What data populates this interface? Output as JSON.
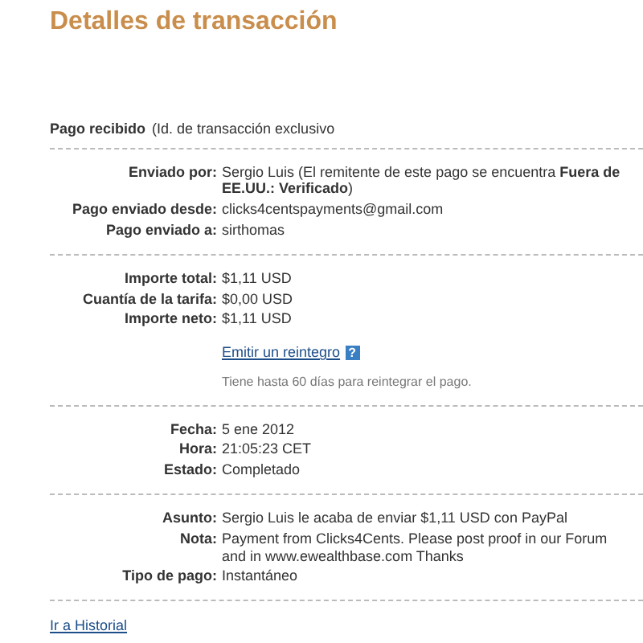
{
  "title": "Detalles de transacción",
  "intro": {
    "label": "Pago recibido",
    "text": "(Id. de transacción exclusivo"
  },
  "sections": [
    {
      "rows": [
        {
          "kind": "field",
          "label": "Enviado por:",
          "value": "Sergio Luis (El remitente de este pago se encuentra **Fuera de EE.UU.: Verificado**)"
        },
        {
          "kind": "field",
          "label": "Pago enviado desde:",
          "value": "clicks4centspayments@gmail.com"
        },
        {
          "kind": "field",
          "label": "Pago enviado a:",
          "value": "sirthomas"
        }
      ]
    },
    {
      "rows": [
        {
          "kind": "field",
          "label": "Importe total:",
          "value": "$1,11 USD"
        },
        {
          "kind": "field",
          "label": "Cuantía de la tarifa:",
          "value": "$0,00 USD"
        },
        {
          "kind": "field",
          "label": "Importe neto:",
          "value": "$1,11 USD"
        },
        {
          "kind": "link",
          "value": "Emitir un reintegro",
          "help": "?"
        },
        {
          "kind": "hint",
          "value": "Tiene hasta 60 días para reintegrar el pago."
        }
      ]
    },
    {
      "rows": [
        {
          "kind": "field",
          "label": "Fecha:",
          "value": "5 ene 2012"
        },
        {
          "kind": "field",
          "label": "Hora:",
          "value": "21:05:23 CET"
        },
        {
          "kind": "field",
          "label": "Estado:",
          "value": "Completado"
        }
      ]
    },
    {
      "rows": [
        {
          "kind": "field",
          "label": "Asunto:",
          "value": "Sergio Luis le acaba de enviar $1,11 USD con PayPal"
        },
        {
          "kind": "field",
          "label": "Nota:",
          "value": "Payment from Clicks4Cents. Please post proof in our Forum and in www.ewealthbase.com Thanks"
        },
        {
          "kind": "field",
          "label": "Tipo de pago:",
          "value": "Instantáneo"
        }
      ]
    }
  ],
  "history_link": "Ir a Historial"
}
